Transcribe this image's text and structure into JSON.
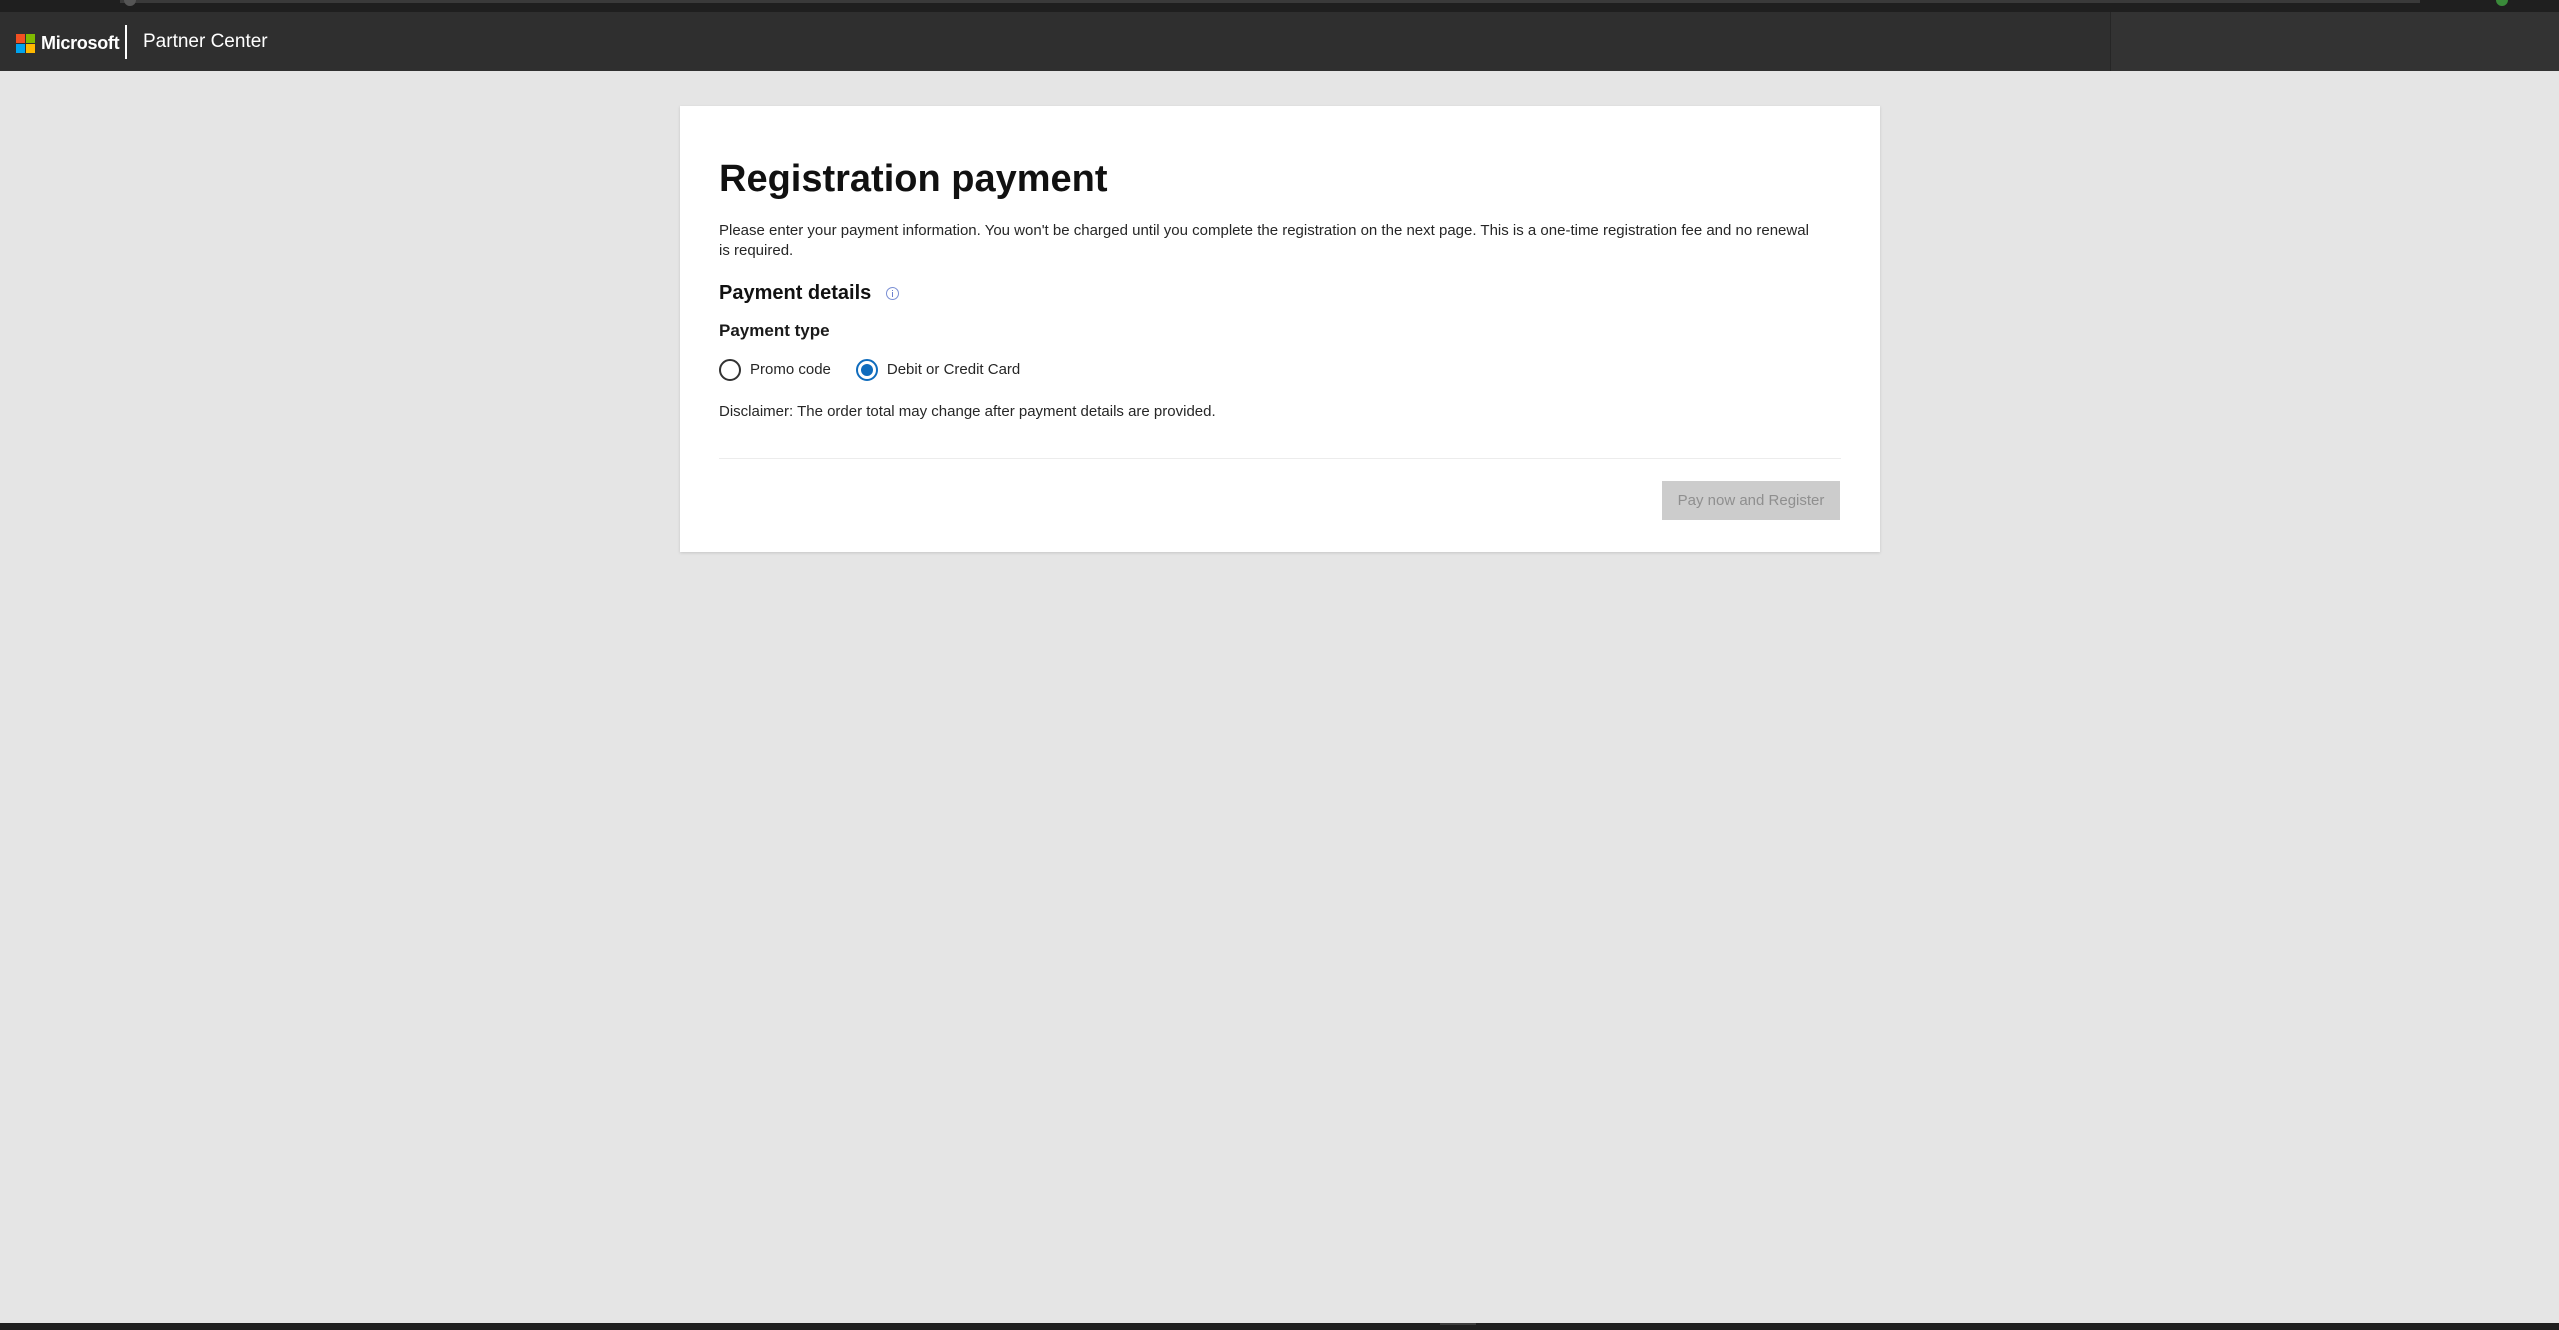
{
  "header": {
    "brand": "Microsoft",
    "product": "Partner Center"
  },
  "colors": {
    "header_bg": "#2f2f2f",
    "page_bg": "#e5e5e5",
    "accent": "#0f6cbd",
    "button_disabled_bg": "#cccccc",
    "logo_red": "#f25022",
    "logo_green": "#7fba00",
    "logo_blue": "#00a4ef",
    "logo_yellow": "#ffb900"
  },
  "main": {
    "title": "Registration payment",
    "intro": "Please enter your payment information. You won't be charged until you complete the registration on the next page. This is a one-time registration fee and no renewal is required.",
    "section_title": "Payment details",
    "section_icon": "info-icon",
    "payment_type_label": "Payment type",
    "payment_options": [
      {
        "label": "Promo code",
        "selected": false
      },
      {
        "label": "Debit or Credit Card",
        "selected": true
      }
    ],
    "disclaimer": "Disclaimer: The order total may change after payment details are provided.",
    "submit_label": "Pay now and Register",
    "submit_enabled": false
  }
}
